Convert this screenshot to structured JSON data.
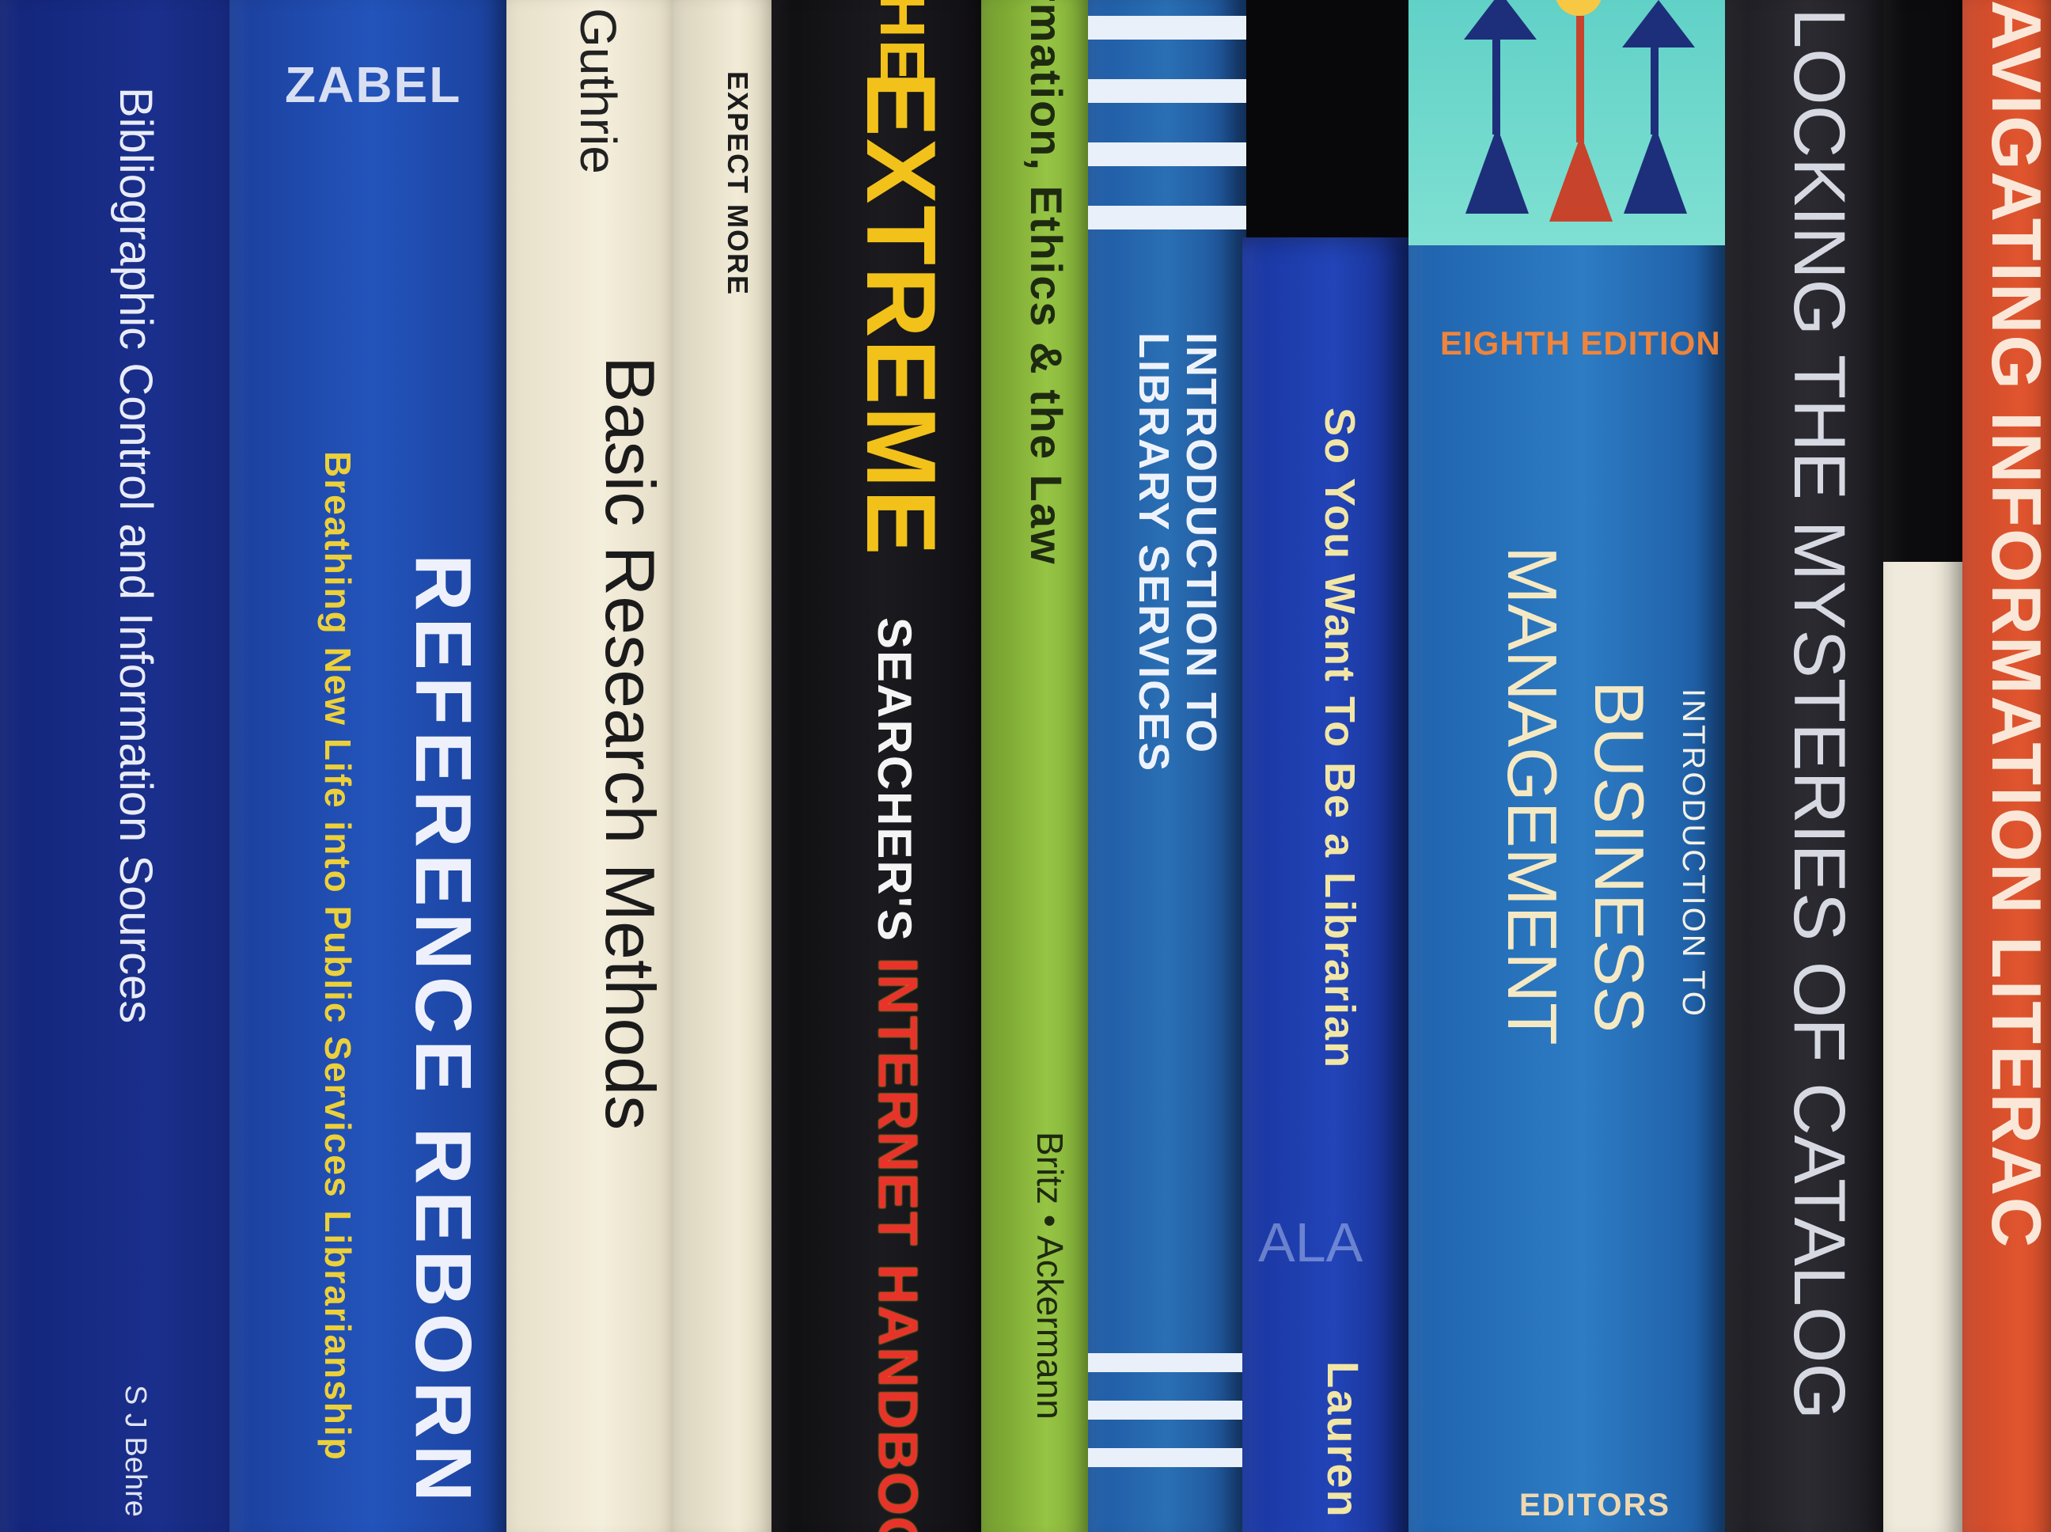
{
  "books": [
    {
      "title": "Bibliographic Control and Information Sources",
      "author": "S J Behre"
    },
    {
      "publisher": "ZABEL",
      "title": "REFERENCE REBORN",
      "subtitle": "Breathing New Life into Public Services Librarianship"
    },
    {
      "author": "Guthrie",
      "title": "Basic Research Methods"
    },
    {
      "title": "EXPECT MORE"
    },
    {
      "title_prefix": "HE",
      "title_main": "EXTREME",
      "title_rest": "SEARCHER'S",
      "title_end": "INTERNET HANDBOO"
    },
    {
      "title": "rmation, Ethics & the Law",
      "authors": "Britz • Ackermann"
    },
    {
      "title_line1": "INTRODUCTION TO",
      "title_line2": "LIBRARY SERVICES"
    },
    {
      "title": "So You Want To Be a Librarian",
      "author": "Lauren",
      "publisher": "ALA"
    },
    {
      "edition": "EIGHTH EDITION",
      "title_pre": "INTRODUCTION TO",
      "title_line1": "BUSINESS",
      "title_line2": "MANAGEMENT",
      "editors": "EDITORS"
    },
    {
      "title": "LOCKING THE MYSTERIES OF CATALOG"
    },
    {
      "title": "AVIGATING INFORMATION LITERAC"
    }
  ],
  "colors": {
    "navy": "#1a2f8c",
    "royal": "#1e4ab0",
    "cream": "#efe8d4",
    "black": "#141316",
    "lime": "#8fbf3c",
    "teal_blue": "#2a6fb4",
    "charcoal": "#26262b",
    "orange": "#e0552e",
    "yellow": "#f2c21a",
    "red": "#e8332a"
  }
}
